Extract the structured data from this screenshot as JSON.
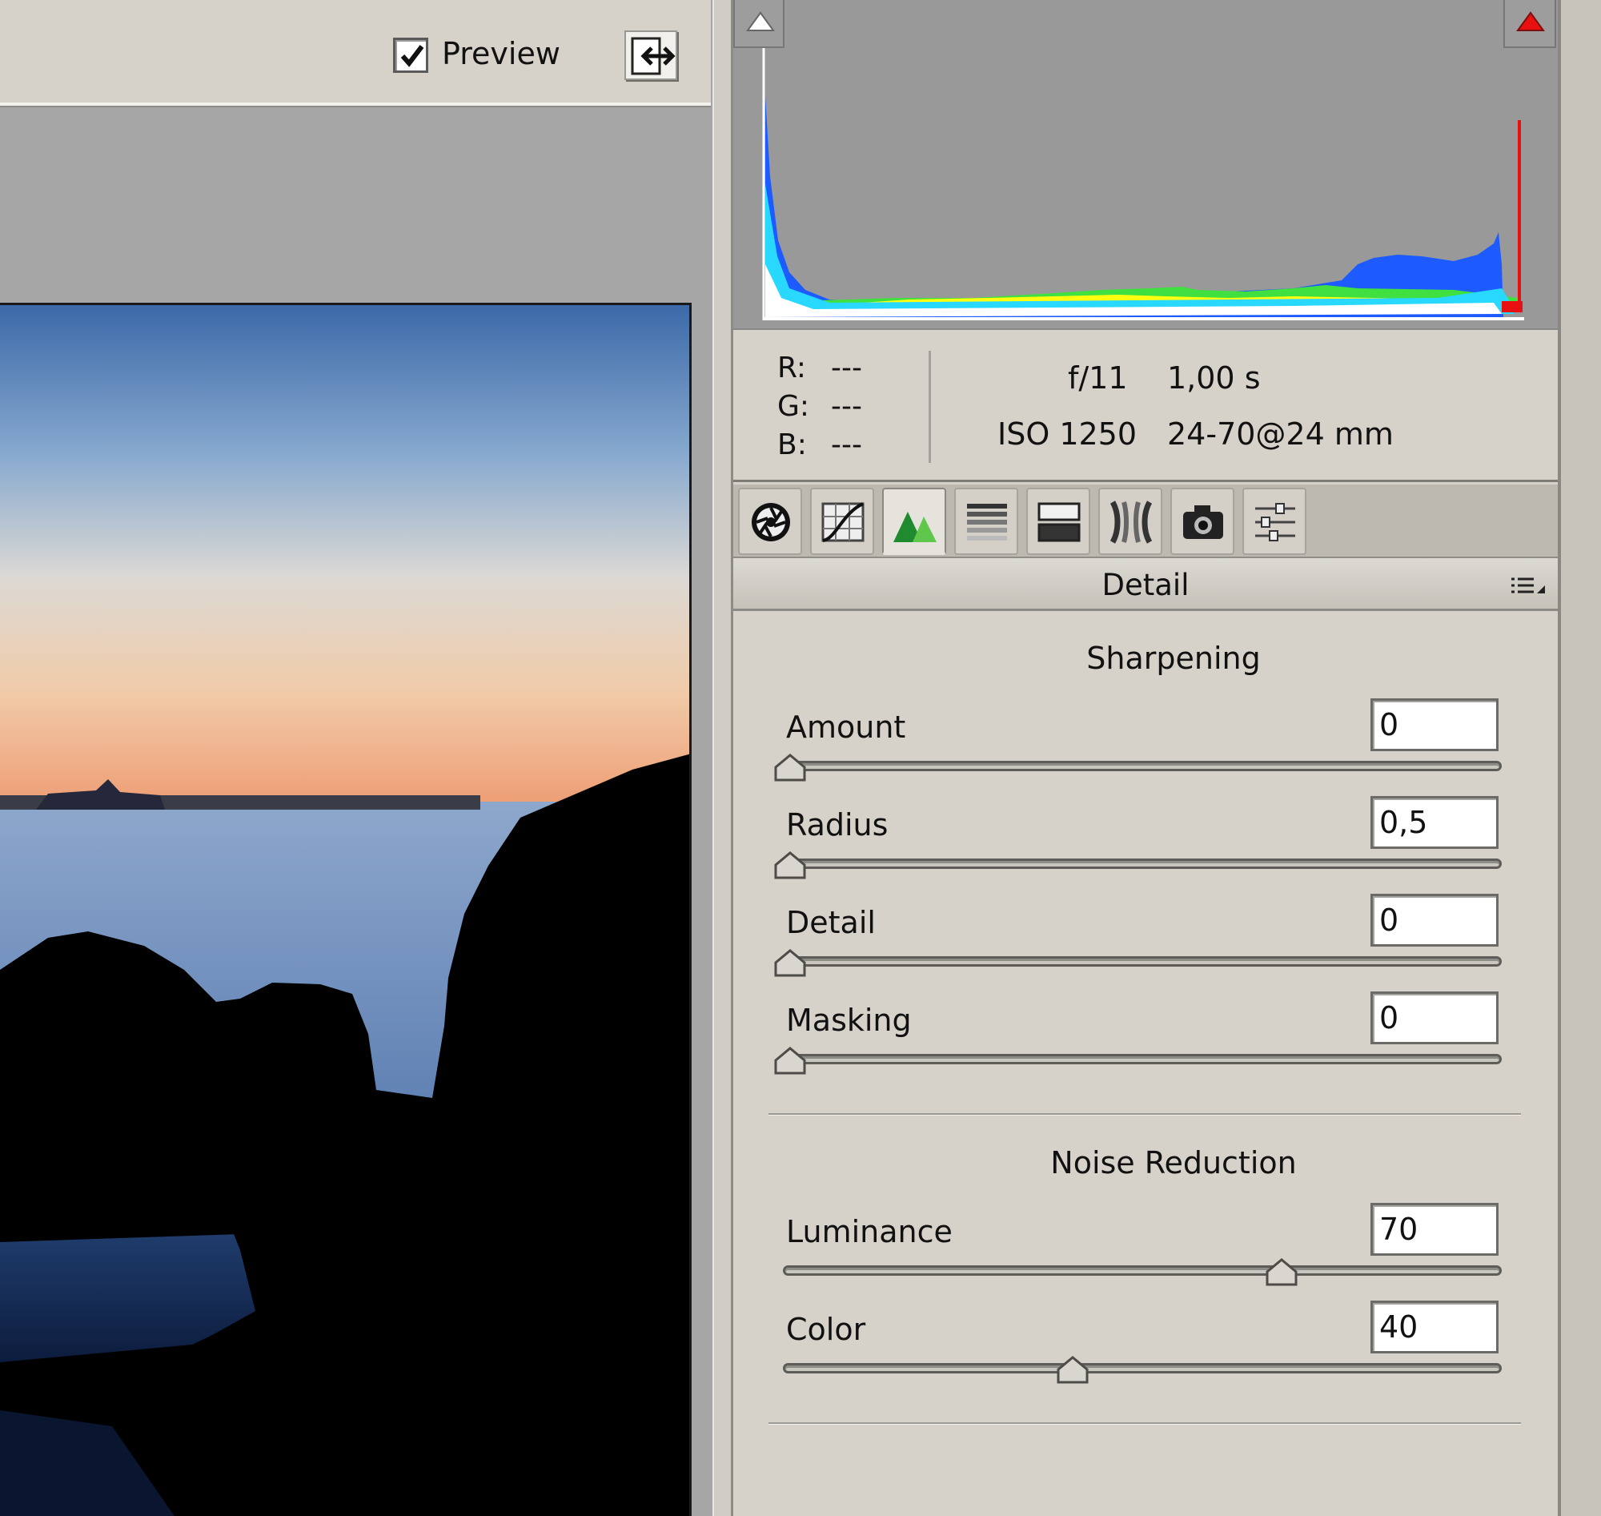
{
  "toolbar": {
    "preview_label": "Preview",
    "preview_checked": true
  },
  "histogram": {
    "shadow_clip_color": "#ffffff",
    "highlight_clip_color": "#e81010"
  },
  "readout": {
    "r_label": "R:",
    "r_value": "---",
    "g_label": "G:",
    "g_value": "---",
    "b_label": "B:",
    "b_value": "---"
  },
  "exif": {
    "aperture": "f/11",
    "shutter": "1,00 s",
    "iso": "ISO 1250",
    "lens": "24-70@24 mm"
  },
  "tabs": [
    {
      "name": "basic",
      "icon": "aperture-icon",
      "active": false
    },
    {
      "name": "tone-curve",
      "icon": "tone-curve-icon",
      "active": false
    },
    {
      "name": "detail",
      "icon": "detail-triangles-icon",
      "active": true
    },
    {
      "name": "hsl",
      "icon": "hsl-grayscale-icon",
      "active": false
    },
    {
      "name": "split-toning",
      "icon": "split-toning-icon",
      "active": false
    },
    {
      "name": "lens-corrections",
      "icon": "lens-corrections-icon",
      "active": false
    },
    {
      "name": "camera-calibration",
      "icon": "camera-icon",
      "active": false
    },
    {
      "name": "presets",
      "icon": "sliders-icon",
      "active": false
    }
  ],
  "panel": {
    "title": "Detail",
    "sharpening": {
      "title": "Sharpening",
      "amount": {
        "label": "Amount",
        "value": "0",
        "fraction": 0.0
      },
      "radius": {
        "label": "Radius",
        "value": "0,5",
        "fraction": 0.0
      },
      "detail": {
        "label": "Detail",
        "value": "0",
        "fraction": 0.0
      },
      "masking": {
        "label": "Masking",
        "value": "0",
        "fraction": 0.0
      }
    },
    "noise_reduction": {
      "title": "Noise Reduction",
      "luminance": {
        "label": "Luminance",
        "value": "70",
        "fraction": 0.7
      },
      "color": {
        "label": "Color",
        "value": "40",
        "fraction": 0.4
      }
    }
  }
}
